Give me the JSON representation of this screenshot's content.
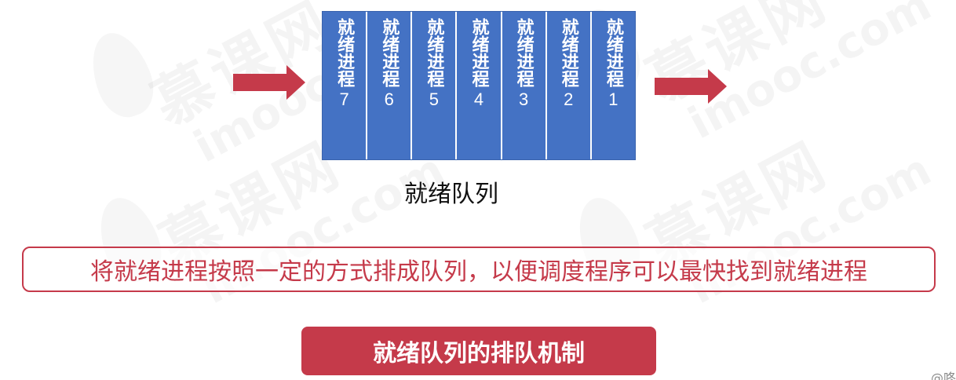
{
  "watermark": {
    "cn": "慕课网",
    "en": "imooc.com"
  },
  "queue": {
    "processes": [
      {
        "label": "就绪进程",
        "num": "7"
      },
      {
        "label": "就绪进程",
        "num": "6"
      },
      {
        "label": "就绪进程",
        "num": "5"
      },
      {
        "label": "就绪进程",
        "num": "4"
      },
      {
        "label": "就绪进程",
        "num": "3"
      },
      {
        "label": "就绪进程",
        "num": "2"
      },
      {
        "label": "就绪进程",
        "num": "1"
      }
    ],
    "caption": "就绪队列",
    "color": "#4472c4"
  },
  "description": "将就绪进程按照一定的方式排成队列，以便调度程序可以最快找到就绪进程",
  "title": "就绪队列的排队机制",
  "corner_mark": "@咚",
  "colors": {
    "accent": "#c53a4a",
    "queue_fill": "#4472c4"
  }
}
